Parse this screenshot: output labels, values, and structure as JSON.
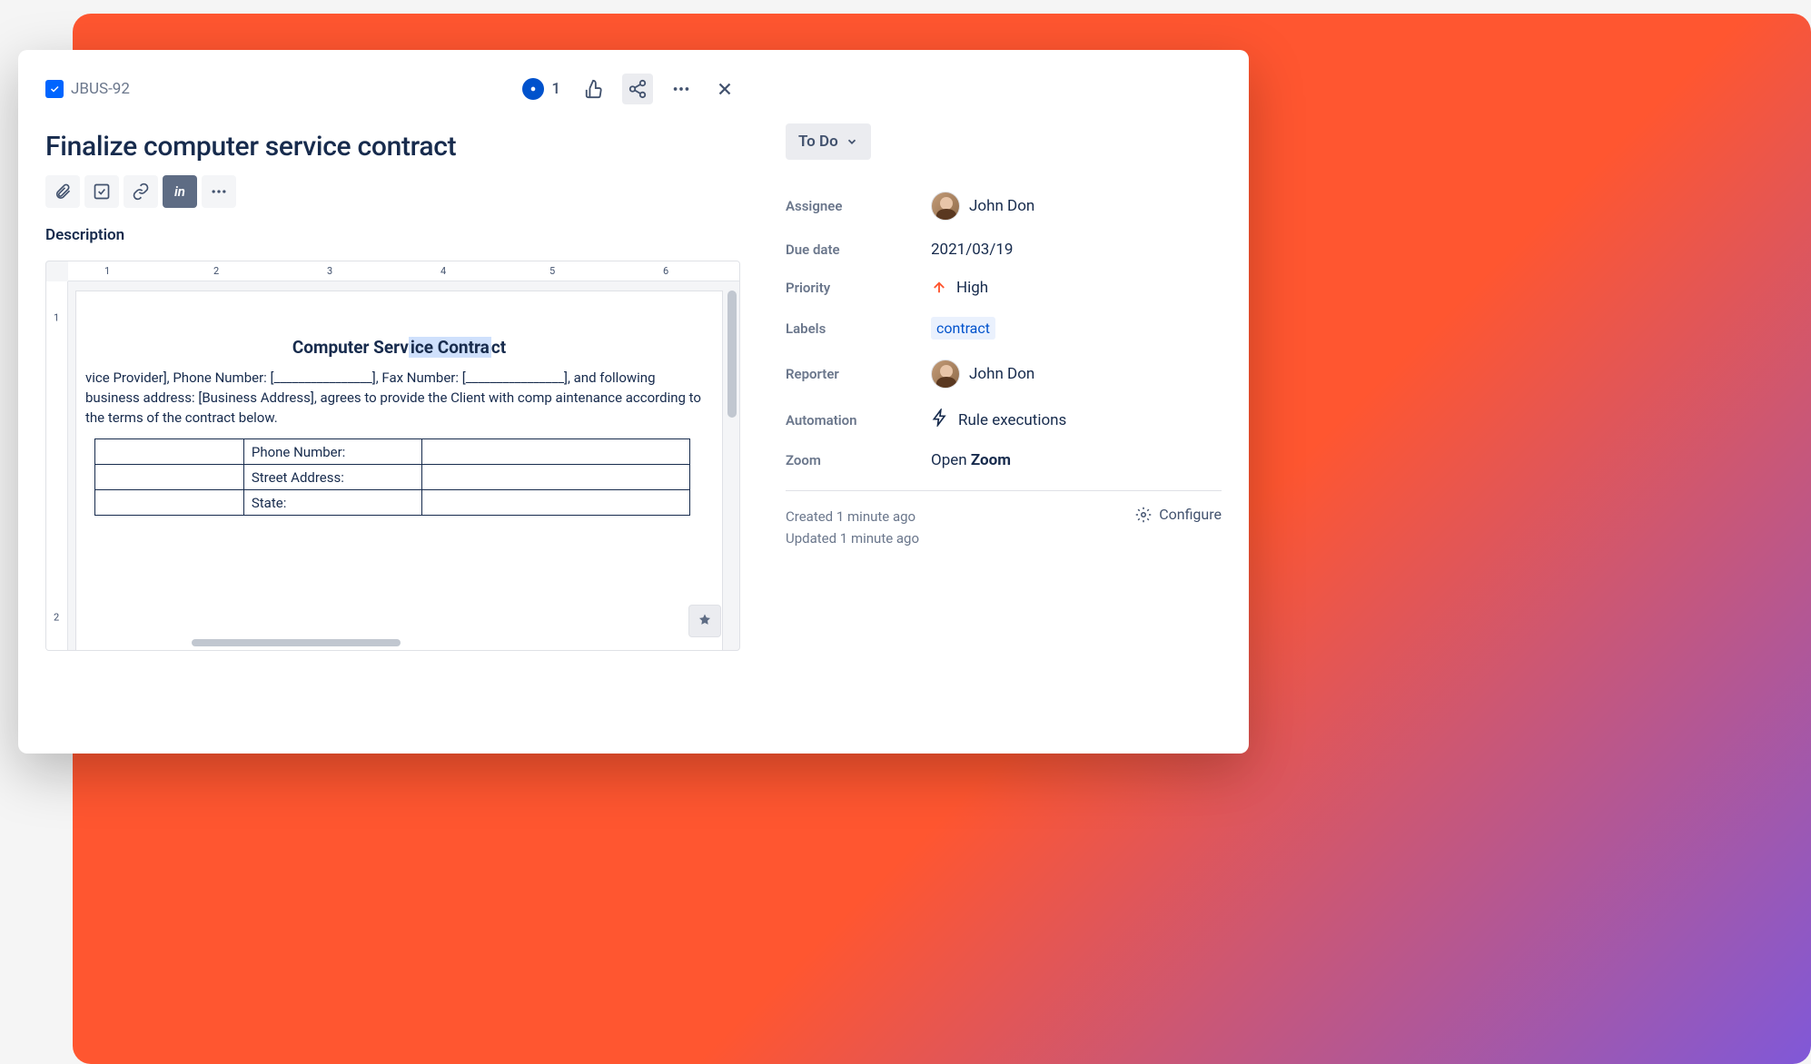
{
  "issue": {
    "key": "JBUS-92",
    "title": "Finalize computer service contract",
    "watch_count": "1",
    "status": "To Do",
    "description_label": "Description"
  },
  "fields": {
    "assignee": {
      "label": "Assignee",
      "value": "John Don"
    },
    "due_date": {
      "label": "Due date",
      "value": "2021/03/19"
    },
    "priority": {
      "label": "Priority",
      "value": "High"
    },
    "labels": {
      "label": "Labels",
      "value": "contract"
    },
    "reporter": {
      "label": "Reporter",
      "value": "John Don"
    },
    "automation": {
      "label": "Automation",
      "value": "Rule executions"
    },
    "zoom": {
      "label": "Zoom",
      "open": "Open ",
      "app": "Zoom"
    }
  },
  "meta": {
    "created": "Created 1 minute ago",
    "updated": "Updated 1 minute ago",
    "configure": "Configure"
  },
  "doc": {
    "title_pre": "Computer Serv",
    "title_hl": "ice Contra",
    "title_post": "ct",
    "body": "vice Provider], Phone Number: [________________], Fax Number: [________________], and following business address: [Business Address], agrees to provide the Client with comp aintenance according to the terms of the contract below.",
    "rows": [
      "Phone Number:",
      "Street Address:",
      "State:"
    ],
    "ruler_h": [
      "1",
      "2",
      "3",
      "4",
      "5",
      "6"
    ],
    "ruler_v": [
      "1",
      "2"
    ]
  }
}
